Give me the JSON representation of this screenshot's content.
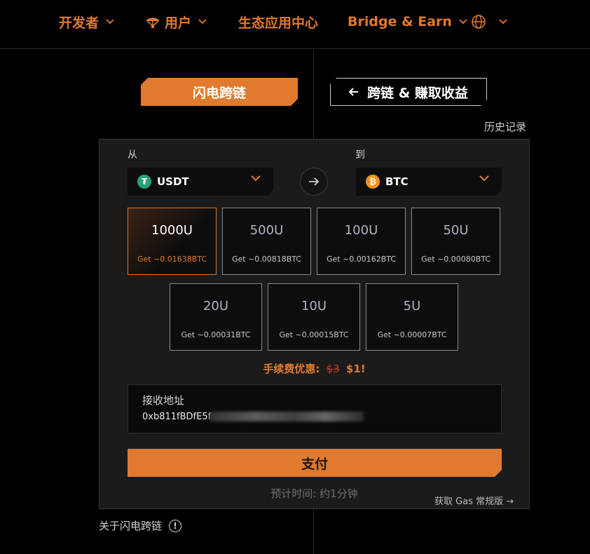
{
  "nav": {
    "developers": "开发者",
    "users": "用户",
    "ecosystem": "生态应用中心",
    "bridge_earn": "Bridge & Earn"
  },
  "tabs": {
    "flash_bridge": "闪电跨链",
    "bridge_earn": "跨链 & 赚取收益"
  },
  "history_link": "历史记录",
  "swap": {
    "from_label": "从",
    "to_label": "到",
    "from_token": {
      "symbol": "USDT",
      "icon_color": "#26a17b"
    },
    "to_token": {
      "symbol": "BTC",
      "icon_color": "#f7931a"
    }
  },
  "amounts": [
    {
      "amount": "1000U",
      "get": "Get ~0.01638BTC",
      "selected": true
    },
    {
      "amount": "500U",
      "get": "Get ~0.00818BTC",
      "selected": false
    },
    {
      "amount": "100U",
      "get": "Get ~0.00162BTC",
      "selected": false
    },
    {
      "amount": "50U",
      "get": "Get ~0.00080BTC",
      "selected": false
    },
    {
      "amount": "20U",
      "get": "Get ~0.00031BTC",
      "selected": false
    },
    {
      "amount": "10U",
      "get": "Get ~0.00015BTC",
      "selected": false
    },
    {
      "amount": "5U",
      "get": "Get ~0.00007BTC",
      "selected": false
    }
  ],
  "fee": {
    "label": "手续费优惠:",
    "old_price": "$3",
    "new_price": "$1!"
  },
  "address": {
    "label": "接收地址",
    "value": "0xb811fBDfE5f"
  },
  "pay_button": "支付",
  "estimated_time": "预计时间: 约1分钟",
  "gas_link": "获取 Gas 常规版 →",
  "about": "关于闪电跨链",
  "colors": {
    "accent": "#e07a2e",
    "background": "#000000",
    "panel": "#1b1b1b"
  },
  "icons": {
    "parachute": "parachute-icon",
    "globe": "globe-icon",
    "arrow_left": "arrow-left-icon",
    "arrow_right": "arrow-right-icon",
    "chevron": "chevron-down-icon",
    "info": "info-icon"
  }
}
